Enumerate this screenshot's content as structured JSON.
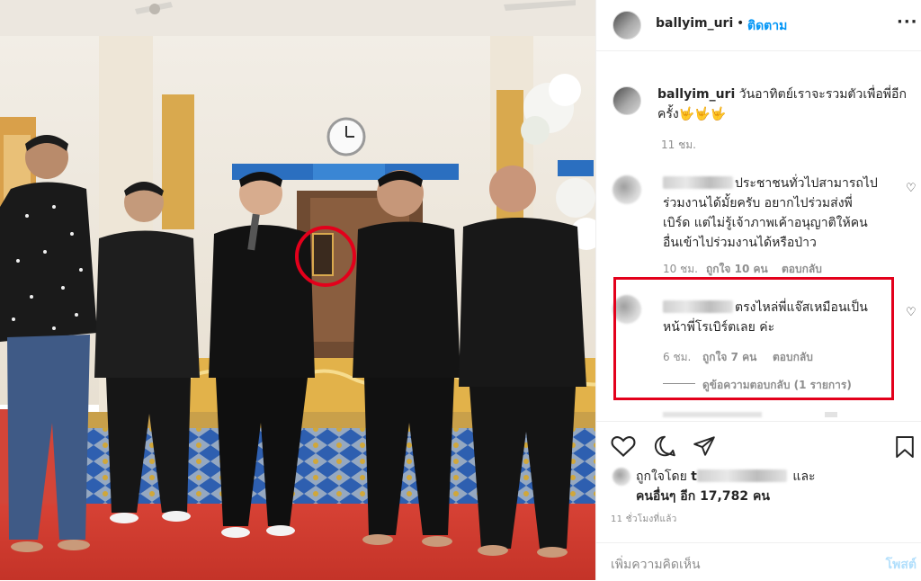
{
  "post": {
    "username": "ballyim_uri",
    "separator": "•",
    "follow_label": "ติดตาม",
    "more_icon": "more-horizontal-icon"
  },
  "caption": {
    "username": "ballyim_uri",
    "text_line1": "วันอาทิตย์เราจะรวมตัวเพื่อพี่อีก",
    "text_line2": "ครั้ง🤟🤟🤟",
    "time": "11 ชม."
  },
  "comments": [
    {
      "lines": [
        "ประชาชนทั่วไปสามารถไป",
        "ร่วมงานได้มั้ยครับ อยากไปร่วมส่งพี่",
        "เบิร์ด แต่ไม่รู้เจ้าภาพเค้าอนุญาติให้คน",
        "อื่นเข้าไปร่วมงานได้หรือป่าว"
      ],
      "time": "10 ชม.",
      "likes": "ถูกใจ 10 คน",
      "reply": "ตอบกลับ"
    },
    {
      "lines": [
        "ตรงไหล่พี่แจ๊สเหมือนเป็น",
        "หน้าพี่โรเบิร์ตเลย ค่ะ"
      ],
      "time": "6 ชม.",
      "likes": "ถูกใจ 7 คน",
      "reply": "ตอบกลับ",
      "view_replies": "ดูข้อความตอบกลับ (1 รายการ)"
    }
  ],
  "likes": {
    "prefix": "ถูกใจโดย",
    "name_partial": "t",
    "and": "และ",
    "others": "คนอื่นๆ อีก 17,782 คน"
  },
  "timestamp": "11 ชั่วโมงที่แล้ว",
  "add_comment": {
    "placeholder": "เพิ่มความคิดเห็น",
    "post_label": "โพสต์"
  },
  "colors": {
    "accent": "#0095f6",
    "highlight": "#e3001b"
  }
}
